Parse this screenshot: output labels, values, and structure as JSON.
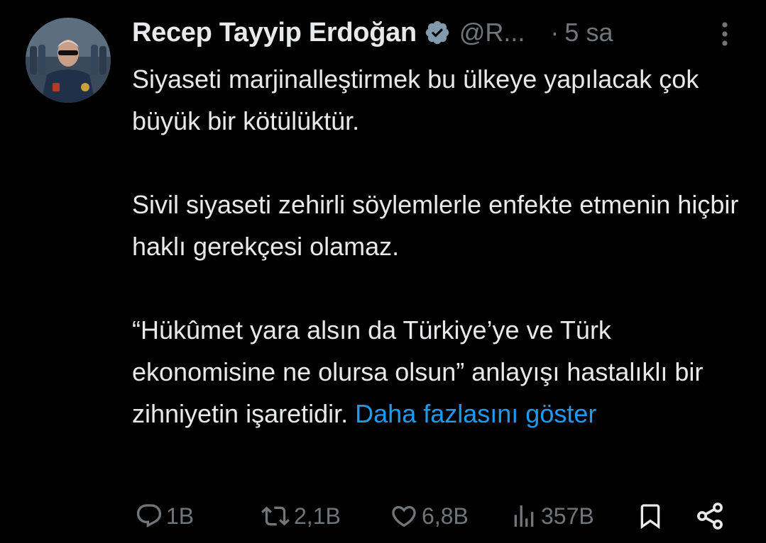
{
  "author": {
    "display_name": "Recep Tayyip Erdoğan",
    "handle": "@R...",
    "separator": "·",
    "time": "5 sa",
    "verified": true
  },
  "tweet": {
    "paragraphs": [
      "Siyaseti marjinalleştirmek bu ülkeye yapılacak çok büyük bir kötülüktür.",
      "Sivil siyaseti zehirli söylemlerle enfekte etmenin hiçbir haklı gerekçesi olamaz.",
      "“Hükûmet yara alsın da Türkiye’ye ve Türk ekonomisine ne olursa olsun” anlayışı hastalıklı bir zihniyetin işaretidir."
    ],
    "show_more": "Daha fazlasını göster"
  },
  "actions": {
    "reply_count": "1B",
    "retweet_count": "2,1B",
    "like_count": "6,8B",
    "views_count": "357B"
  },
  "icons": {
    "more": "more-vertical-icon",
    "verified": "verified-badge-icon",
    "reply": "reply-icon",
    "retweet": "retweet-icon",
    "like": "heart-icon",
    "views": "views-icon",
    "bookmark": "bookmark-icon",
    "share": "share-icon"
  },
  "colors": {
    "background": "#000000",
    "text": "#e7e9ea",
    "muted": "#71767b",
    "link": "#1d9bf0"
  }
}
